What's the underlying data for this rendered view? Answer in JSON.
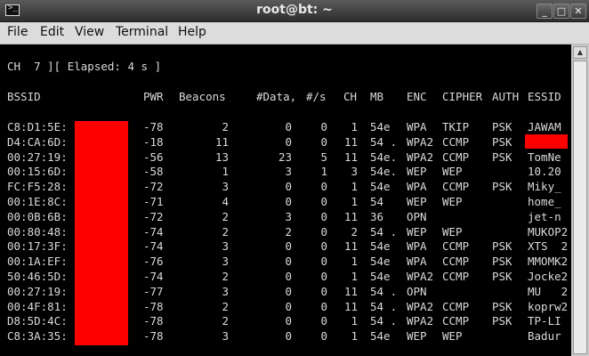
{
  "window": {
    "title": "root@bt: ~",
    "app_icon_glyph": ">_",
    "buttons": {
      "minimize": "_",
      "maximize": "□",
      "close": "✕"
    }
  },
  "menu": [
    "File",
    "Edit",
    "View",
    "Terminal",
    "Help"
  ],
  "status_line": "CH  7 ][ Elapsed: 4 s ]",
  "table": {
    "headers": [
      "BSSID",
      "PWR",
      "Beacons",
      "#Data,",
      "#/s",
      "CH",
      "MB",
      "ENC",
      "CIPHER",
      "AUTH",
      "ESSID"
    ],
    "rows": [
      {
        "bssid": "C8:D1:5E:",
        "pwr": "-78",
        "beacons": "2",
        "data": "0",
        "s": "0",
        "ch": "1",
        "mb": "54e",
        "enc": "WPA",
        "cipher": "TKIP",
        "auth": "PSK",
        "essid": "JAWAM"
      },
      {
        "bssid": "D4:CA:6D:",
        "pwr": "-18",
        "beacons": "11",
        "data": "0",
        "s": "0",
        "ch": "11",
        "mb": "54 .",
        "enc": "WPA2",
        "cipher": "CCMP",
        "auth": "PSK",
        "essid": ""
      },
      {
        "bssid": "00:27:19:",
        "pwr": "-56",
        "beacons": "13",
        "data": "23",
        "s": "5",
        "ch": "11",
        "mb": "54e.",
        "enc": "WPA2",
        "cipher": "CCMP",
        "auth": "PSK",
        "essid": "TomNe"
      },
      {
        "bssid": "00:15:6D:",
        "pwr": "-58",
        "beacons": "1",
        "data": "3",
        "s": "1",
        "ch": "3",
        "mb": "54e.",
        "enc": "WEP",
        "cipher": "WEP",
        "auth": "",
        "essid": "10.20"
      },
      {
        "bssid": "FC:F5:28:",
        "pwr": "-72",
        "beacons": "3",
        "data": "0",
        "s": "0",
        "ch": "1",
        "mb": "54e",
        "enc": "WPA",
        "cipher": "CCMP",
        "auth": "PSK",
        "essid": "Miky_"
      },
      {
        "bssid": "00:1E:8C:",
        "pwr": "-71",
        "beacons": "4",
        "data": "0",
        "s": "0",
        "ch": "1",
        "mb": "54",
        "enc": "WEP",
        "cipher": "WEP",
        "auth": "",
        "essid": "home_"
      },
      {
        "bssid": "00:0B:6B:",
        "pwr": "-72",
        "beacons": "2",
        "data": "3",
        "s": "0",
        "ch": "11",
        "mb": "36",
        "enc": "OPN",
        "cipher": "",
        "auth": "",
        "essid": "jet-n"
      },
      {
        "bssid": "00:80:48:",
        "pwr": "-74",
        "beacons": "2",
        "data": "2",
        "s": "0",
        "ch": "2",
        "mb": "54 .",
        "enc": "WEP",
        "cipher": "WEP",
        "auth": "",
        "essid": "MUKOP2"
      },
      {
        "bssid": "00:17:3F:",
        "pwr": "-74",
        "beacons": "3",
        "data": "0",
        "s": "0",
        "ch": "11",
        "mb": "54e",
        "enc": "WPA",
        "cipher": "CCMP",
        "auth": "PSK",
        "essid": "XTS  2"
      },
      {
        "bssid": "00:1A:EF:",
        "pwr": "-76",
        "beacons": "3",
        "data": "0",
        "s": "0",
        "ch": "1",
        "mb": "54e",
        "enc": "WPA",
        "cipher": "CCMP",
        "auth": "PSK",
        "essid": "MMOMK2"
      },
      {
        "bssid": "50:46:5D:",
        "pwr": "-74",
        "beacons": "2",
        "data": "0",
        "s": "0",
        "ch": "1",
        "mb": "54e",
        "enc": "WPA2",
        "cipher": "CCMP",
        "auth": "PSK",
        "essid": "Jocke2"
      },
      {
        "bssid": "00:27:19:",
        "pwr": "-77",
        "beacons": "3",
        "data": "0",
        "s": "0",
        "ch": "11",
        "mb": "54 .",
        "enc": "OPN",
        "cipher": "",
        "auth": "",
        "essid": "MU   2"
      },
      {
        "bssid": "00:4F:81:",
        "pwr": "-78",
        "beacons": "2",
        "data": "0",
        "s": "0",
        "ch": "11",
        "mb": "54 .",
        "enc": "WPA2",
        "cipher": "CCMP",
        "auth": "PSK",
        "essid": "koprw2"
      },
      {
        "bssid": "D8:5D:4C:",
        "pwr": "-78",
        "beacons": "2",
        "data": "0",
        "s": "0",
        "ch": "1",
        "mb": "54 .",
        "enc": "WPA2",
        "cipher": "CCMP",
        "auth": "PSK",
        "essid": "TP-LI"
      },
      {
        "bssid": "C8:3A:35:",
        "pwr": "-78",
        "beacons": "3",
        "data": "0",
        "s": "0",
        "ch": "1",
        "mb": "54e",
        "enc": "WEP",
        "cipher": "WEP",
        "auth": "",
        "essid": "Badur"
      }
    ]
  },
  "colors": {
    "terminal_bg": "#000000",
    "terminal_fg": "#dadada",
    "redaction": "#ff0000"
  }
}
